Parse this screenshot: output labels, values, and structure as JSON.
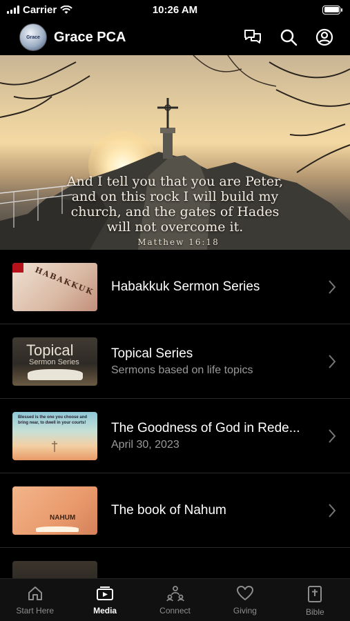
{
  "status_bar": {
    "carrier": "Carrier",
    "time": "10:26 AM",
    "battery_level": 1.0
  },
  "nav": {
    "title": "Grace PCA",
    "logo_text": "Grace",
    "icons": [
      "chat-icon",
      "search-icon",
      "account-icon"
    ]
  },
  "hero": {
    "verse_lines": [
      "And I tell you that you are Peter,",
      "and on this rock I will build my",
      "church, and the gates of Hades",
      "will not overcome it."
    ],
    "reference": "Matthew 16:18"
  },
  "media_items": [
    {
      "title": "Habakkuk Sermon Series",
      "subtitle": "",
      "thumb_text": "HABAKKUK"
    },
    {
      "title": "Topical Series",
      "subtitle": "Sermons based on life topics",
      "thumb_text_1": "Topical",
      "thumb_text_2": "Sermon Series"
    },
    {
      "title": "The Goodness of God in Rede...",
      "subtitle": "April 30, 2023",
      "thumb_text": "Blessed is the one you choose and bring near, to dwell in your courts!"
    },
    {
      "title": "The book of Nahum",
      "subtitle": "",
      "thumb_text": "NAHUM"
    },
    {
      "title": "",
      "subtitle": ""
    }
  ],
  "tabs": [
    {
      "label": "Start Here",
      "icon": "home-icon",
      "active": false
    },
    {
      "label": "Media",
      "icon": "media-icon",
      "active": true
    },
    {
      "label": "Connect",
      "icon": "connect-icon",
      "active": false
    },
    {
      "label": "Giving",
      "icon": "heart-icon",
      "active": false
    },
    {
      "label": "Bible",
      "icon": "bible-icon",
      "active": false
    }
  ],
  "colors": {
    "background": "#000000",
    "text": "#ffffff",
    "subtext": "#9a9a9a",
    "tab_inactive": "#8e8e8e"
  }
}
